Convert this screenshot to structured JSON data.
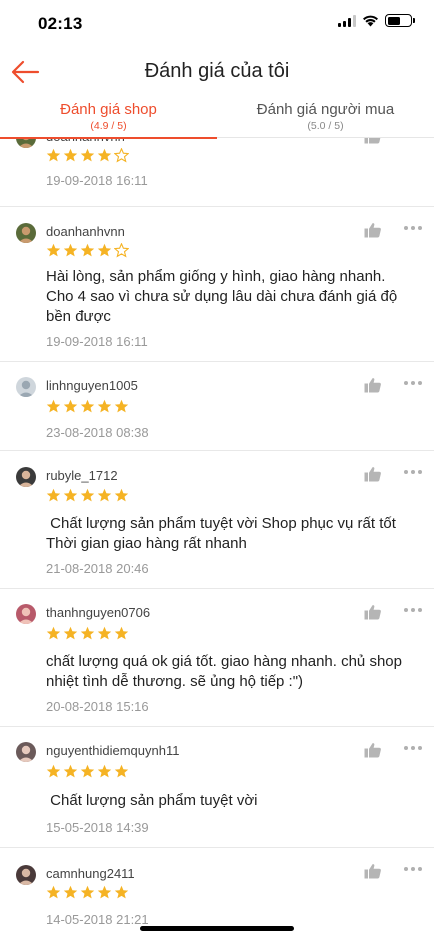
{
  "status_bar": {
    "time": "02:13"
  },
  "header": {
    "title": "Đánh giá của tôi"
  },
  "tabs": [
    {
      "label": "Đánh giá shop",
      "sub": "(4.9 / 5)",
      "active": true
    },
    {
      "label": "Đánh giá người mua",
      "sub": "(5.0 / 5)",
      "active": false
    }
  ],
  "colors": {
    "accent": "#ee4d2d",
    "star": "#f5b324",
    "star_empty": "#f5b324"
  },
  "reviews": [
    {
      "username": "doanhanhvnn",
      "rating": 4,
      "text": "",
      "date": "19-09-2018 16:11"
    },
    {
      "username": "doanhanhvnn",
      "rating": 4,
      "text": "Hài lòng, sản phẩm giống y hình, giao hàng nhanh. Cho 4 sao vì chưa sử dụng lâu dài chưa đánh giá độ bền được",
      "date": "19-09-2018 16:11"
    },
    {
      "username": "linhnguyen1005",
      "rating": 5,
      "text": "",
      "date": "23-08-2018 08:38"
    },
    {
      "username": "rubyle_1712",
      "rating": 5,
      "text": " Chất lượng sản phẩm tuyệt vời Shop phục vụ rất tốt\nThời gian giao hàng rất nhanh",
      "date": "21-08-2018 20:46"
    },
    {
      "username": "thanhnguyen0706",
      "rating": 5,
      "text": "chất lượng quá ok giá tốt. giao hàng nhanh. chủ shop nhiệt tình dễ thương. sẽ ủng hộ tiếp :\")",
      "date": "20-08-2018 15:16"
    },
    {
      "username": "nguyenthidiemquynh11",
      "rating": 5,
      "text": " Chất lượng sản phẩm tuyệt vời",
      "date": "15-05-2018 14:39"
    },
    {
      "username": "camnhung2411",
      "rating": 5,
      "text": "",
      "date": "14-05-2018 21:21"
    }
  ]
}
